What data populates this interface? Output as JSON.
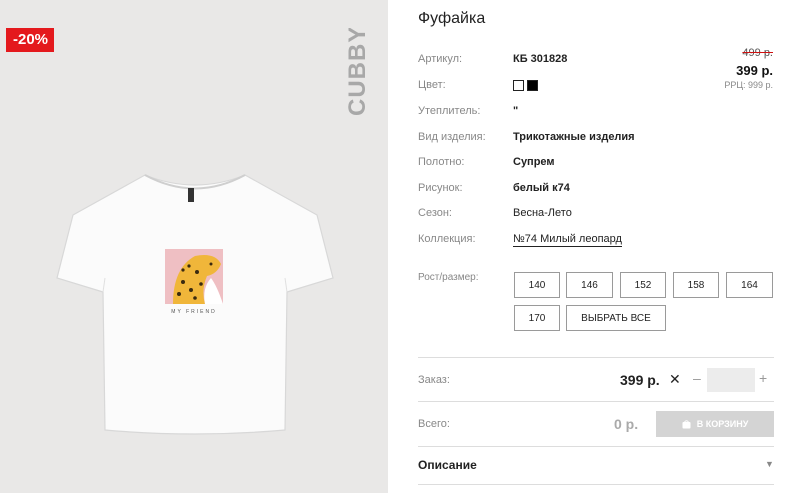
{
  "product": {
    "discount_badge": "-20%",
    "brand": "CUBBY",
    "print_caption": "MY FRIEND",
    "title": "Фуфайка"
  },
  "price": {
    "old": "499 р.",
    "current": "399 р.",
    "rrp": "РРЦ: 999 р."
  },
  "attributes": [
    {
      "label": "Артикул:",
      "value": "КБ 301828"
    },
    {
      "label": "Цвет:",
      "value": "",
      "swatches": [
        "#ffffff",
        "#000000"
      ]
    },
    {
      "label": "Утеплитель:",
      "value": "\""
    },
    {
      "label": "Вид изделия:",
      "value": "Трикотажные изделия"
    },
    {
      "label": "Полотно:",
      "value": "Супрем"
    },
    {
      "label": "Рисунок:",
      "value": "белый к74"
    },
    {
      "label": "Сезон:",
      "value": "Весна-Лето"
    },
    {
      "label": "Коллекция:",
      "value": "№74 Милый леопард"
    }
  ],
  "sizes": {
    "label": "Рост/размер:",
    "options": [
      "140",
      "146",
      "152",
      "158",
      "164",
      "170"
    ],
    "select_all": "ВЫБРАТЬ ВСЕ"
  },
  "order": {
    "label": "Заказ:",
    "price": "399 р.",
    "times": "✕",
    "minus": "–",
    "plus": "+",
    "quantity": ""
  },
  "total": {
    "label": "Всего:",
    "value": "0 р.",
    "cart_button": "В КОРЗИНУ"
  },
  "description": {
    "label": "Описание",
    "arrow": "▼"
  },
  "colors": {
    "badge": "#e4191d",
    "old_price_strike": "#d01010",
    "cart_button_bg": "#d4d4d4",
    "photo_bg": "#e9e8e7"
  }
}
